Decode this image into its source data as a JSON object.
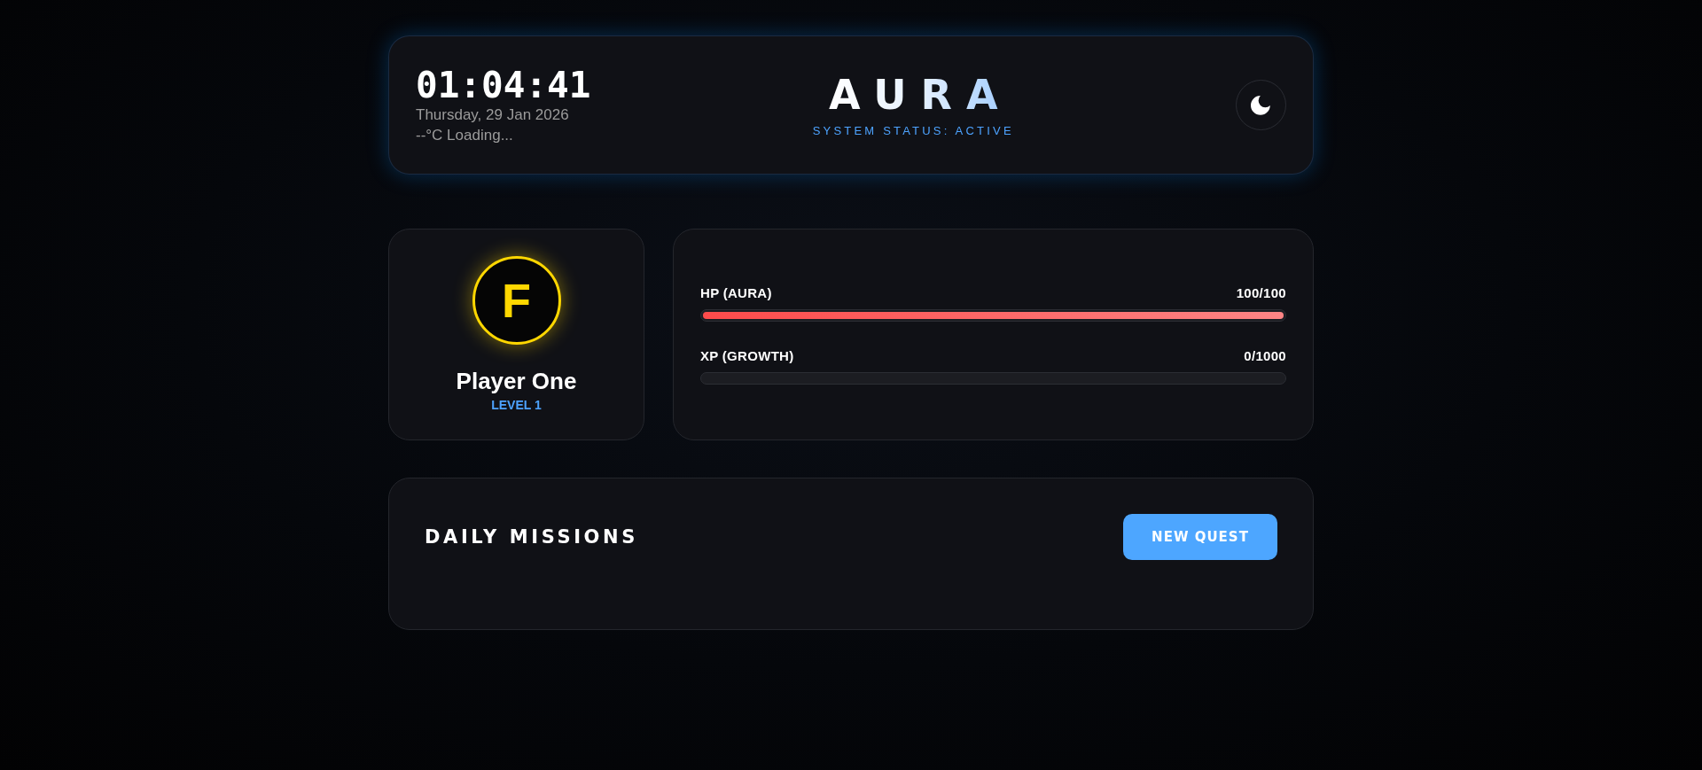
{
  "header": {
    "clock": "01:04:41",
    "date": "Thursday, 29 Jan 2026",
    "weather": "--°C Loading...",
    "logo": "AURA",
    "status": "SYSTEM STATUS: ACTIVE"
  },
  "profile": {
    "initial": "F",
    "name": "Player One",
    "level_label": "LEVEL 1"
  },
  "stats": [
    {
      "label": "HP (AURA)",
      "reading": "100/100",
      "level": 1
    },
    {
      "label": "XP (GROWTH)",
      "reading": "0/1000",
      "level": 0
    }
  ],
  "missions": {
    "title": "DAILY MISSIONS",
    "button": "NEW QUEST"
  }
}
